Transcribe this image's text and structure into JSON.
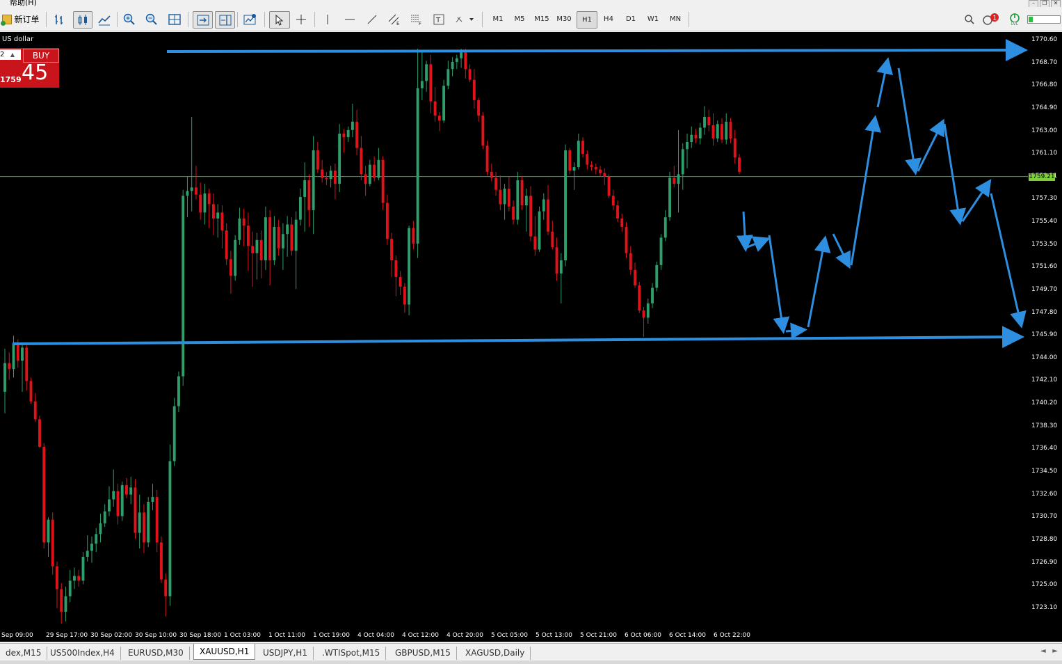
{
  "menu": {
    "help_label": "帮助(H)"
  },
  "toolbar": {
    "new_order_label": "新订单",
    "timeframes": [
      "M1",
      "M5",
      "M15",
      "M30",
      "H1",
      "H4",
      "D1",
      "W1",
      "MN"
    ],
    "active_timeframe": "H1",
    "alert_count": "1",
    "lvl_label": "LVL"
  },
  "chart": {
    "symbol_description": "US dollar",
    "lot_value": "2",
    "buy_label": "BUY",
    "price_small": "1759",
    "price_big": "45",
    "current_price": "1759.21",
    "colors": {
      "background": "#000000",
      "bull": "#2e9e6b",
      "bear": "#e0131b",
      "grid_line": "#22c03a",
      "drawing": "#2e8ee0"
    }
  },
  "price_axis_labels": [
    "1770.60",
    "1768.70",
    "1766.80",
    "1764.90",
    "1763.00",
    "1761.10",
    "1759.21",
    "1757.30",
    "1755.40",
    "1753.50",
    "1751.60",
    "1749.70",
    "1747.80",
    "1745.90",
    "1744.00",
    "1742.10",
    "1740.20",
    "1738.30",
    "1736.40",
    "1734.50",
    "1732.60",
    "1730.70",
    "1728.80",
    "1726.90",
    "1725.00",
    "1723.10"
  ],
  "time_axis_labels": [
    "Sep 09:00",
    "29 Sep 17:00",
    "30 Sep 02:00",
    "30 Sep 10:00",
    "30 Sep 18:00",
    "1 Oct 03:00",
    "1 Oct 11:00",
    "1 Oct 19:00",
    "4 Oct 04:00",
    "4 Oct 12:00",
    "4 Oct 20:00",
    "5 Oct 05:00",
    "5 Oct 13:00",
    "5 Oct 21:00",
    "6 Oct 06:00",
    "6 Oct 14:00",
    "6 Oct 22:00"
  ],
  "tabs": [
    "dex,M15",
    "US500Index,H4",
    "EURUSD,M30",
    "XAUUSD,H1",
    "USDJPY,H1",
    ".WTISpot,M15",
    "GBPUSD,M15",
    "XAGUSD,Daily"
  ],
  "active_tab": "XAUUSD,H1",
  "chart_data": {
    "type": "candlestick",
    "symbol": "XAUUSD",
    "timeframe": "H1",
    "ylim": [
      1721.4,
      1771.3
    ],
    "horizontal_line": 1759.21,
    "candles": [
      [
        1741.2,
        1744.8,
        1739.4,
        1743.6
      ],
      [
        1743.6,
        1744.5,
        1742.2,
        1743.1
      ],
      [
        1743.1,
        1745.9,
        1742.4,
        1745.2
      ],
      [
        1745.2,
        1745.6,
        1743.2,
        1743.8
      ],
      [
        1743.8,
        1745.3,
        1741.2,
        1744.9
      ],
      [
        1744.9,
        1745.1,
        1741.3,
        1742.1
      ],
      [
        1742.1,
        1742.4,
        1740.2,
        1740.4
      ],
      [
        1740.4,
        1741.1,
        1738.7,
        1738.9
      ],
      [
        1738.9,
        1739.2,
        1736.5,
        1736.6
      ],
      [
        1736.6,
        1736.9,
        1728.1,
        1728.6
      ],
      [
        1728.6,
        1730.7,
        1727.4,
        1730.5
      ],
      [
        1730.5,
        1731.1,
        1725.9,
        1726.6
      ],
      [
        1726.6,
        1727.0,
        1723.1,
        1724.7
      ],
      [
        1724.7,
        1725.2,
        1721.8,
        1722.8
      ],
      [
        1722.8,
        1724.9,
        1722.0,
        1724.1
      ],
      [
        1724.1,
        1726.3,
        1723.6,
        1725.4
      ],
      [
        1725.4,
        1726.5,
        1724.7,
        1725.8
      ],
      [
        1725.8,
        1726.3,
        1724.9,
        1725.4
      ],
      [
        1725.4,
        1727.8,
        1725.1,
        1727.4
      ],
      [
        1727.4,
        1729.2,
        1727.0,
        1727.9
      ],
      [
        1727.9,
        1729.1,
        1726.9,
        1728.5
      ],
      [
        1728.5,
        1729.8,
        1727.8,
        1729.3
      ],
      [
        1729.3,
        1731.0,
        1728.6,
        1730.2
      ],
      [
        1730.2,
        1731.8,
        1729.9,
        1731.2
      ],
      [
        1731.2,
        1733.3,
        1730.8,
        1732.2
      ],
      [
        1732.2,
        1734.7,
        1731.6,
        1732.9
      ],
      [
        1732.9,
        1733.5,
        1730.1,
        1730.8
      ],
      [
        1730.8,
        1733.7,
        1730.4,
        1733.4
      ],
      [
        1733.4,
        1734.0,
        1732.3,
        1732.6
      ],
      [
        1732.6,
        1734.1,
        1731.8,
        1733.2
      ],
      [
        1733.2,
        1733.9,
        1728.9,
        1729.4
      ],
      [
        1729.4,
        1732.6,
        1728.1,
        1731.1
      ],
      [
        1731.1,
        1731.8,
        1727.7,
        1728.6
      ],
      [
        1728.6,
        1732.4,
        1728.2,
        1732.0
      ],
      [
        1732.0,
        1733.5,
        1731.3,
        1732.4
      ],
      [
        1732.4,
        1733.0,
        1727.8,
        1728.6
      ],
      [
        1728.6,
        1729.1,
        1725.2,
        1725.5
      ],
      [
        1725.5,
        1726.0,
        1722.4,
        1724.1
      ],
      [
        1724.1,
        1736.8,
        1723.3,
        1735.4
      ],
      [
        1735.4,
        1740.7,
        1735.0,
        1740.0
      ],
      [
        1740.0,
        1742.9,
        1739.5,
        1742.5
      ],
      [
        1742.5,
        1758.1,
        1741.7,
        1757.6
      ],
      [
        1757.6,
        1759.2,
        1755.8,
        1758.0
      ],
      [
        1758.0,
        1764.2,
        1756.3,
        1758.3
      ],
      [
        1758.3,
        1760.1,
        1757.3,
        1757.7
      ],
      [
        1757.7,
        1758.7,
        1755.6,
        1756.2
      ],
      [
        1756.2,
        1758.6,
        1755.2,
        1757.8
      ],
      [
        1757.8,
        1758.2,
        1754.9,
        1756.9
      ],
      [
        1756.9,
        1757.8,
        1754.3,
        1755.7
      ],
      [
        1755.7,
        1756.9,
        1754.1,
        1756.2
      ],
      [
        1756.2,
        1756.8,
        1753.2,
        1754.7
      ],
      [
        1754.7,
        1755.3,
        1751.8,
        1752.3
      ],
      [
        1752.3,
        1753.0,
        1749.4,
        1750.9
      ],
      [
        1750.9,
        1754.3,
        1750.5,
        1753.9
      ],
      [
        1753.9,
        1756.6,
        1753.5,
        1755.7
      ],
      [
        1755.7,
        1756.5,
        1753.4,
        1755.1
      ],
      [
        1755.1,
        1756.2,
        1751.3,
        1753.4
      ],
      [
        1753.4,
        1754.6,
        1750.0,
        1752.8
      ],
      [
        1752.8,
        1754.5,
        1750.6,
        1753.9
      ],
      [
        1753.9,
        1754.7,
        1750.7,
        1752.2
      ],
      [
        1752.2,
        1756.7,
        1751.4,
        1755.8
      ],
      [
        1755.8,
        1756.4,
        1750.1,
        1752.2
      ],
      [
        1752.2,
        1755.9,
        1751.8,
        1755.0
      ],
      [
        1755.0,
        1755.6,
        1752.6,
        1753.2
      ],
      [
        1753.2,
        1755.3,
        1751.4,
        1754.4
      ],
      [
        1754.4,
        1755.9,
        1752.5,
        1755.2
      ],
      [
        1755.2,
        1755.8,
        1752.6,
        1753.0
      ],
      [
        1753.0,
        1756.3,
        1749.8,
        1755.6
      ],
      [
        1755.6,
        1758.2,
        1755.1,
        1757.5
      ],
      [
        1757.5,
        1760.4,
        1754.6,
        1758.9
      ],
      [
        1758.9,
        1759.4,
        1755.0,
        1756.4
      ],
      [
        1756.4,
        1762.6,
        1754.4,
        1761.4
      ],
      [
        1761.4,
        1762.1,
        1759.5,
        1759.8
      ],
      [
        1759.8,
        1760.6,
        1758.7,
        1759.1
      ],
      [
        1759.1,
        1759.6,
        1758.5,
        1759.0
      ],
      [
        1759.0,
        1760.1,
        1758.3,
        1759.7
      ],
      [
        1759.7,
        1760.3,
        1757.3,
        1758.6
      ],
      [
        1758.6,
        1763.6,
        1757.9,
        1762.8
      ],
      [
        1762.8,
        1763.2,
        1761.2,
        1762.5
      ],
      [
        1762.5,
        1763.4,
        1762.1,
        1763.1
      ],
      [
        1763.1,
        1765.3,
        1762.5,
        1763.8
      ],
      [
        1763.8,
        1764.8,
        1761.0,
        1761.6
      ],
      [
        1761.6,
        1762.6,
        1758.9,
        1759.4
      ],
      [
        1759.4,
        1760.1,
        1757.6,
        1758.6
      ],
      [
        1758.6,
        1760.6,
        1758.4,
        1760.2
      ],
      [
        1760.2,
        1760.9,
        1758.8,
        1759.1
      ],
      [
        1759.1,
        1761.6,
        1758.9,
        1760.6
      ],
      [
        1760.6,
        1760.9,
        1756.4,
        1757.0
      ],
      [
        1757.0,
        1757.7,
        1753.5,
        1754.0
      ],
      [
        1754.0,
        1754.5,
        1750.8,
        1752.2
      ],
      [
        1752.2,
        1752.6,
        1749.2,
        1750.8
      ],
      [
        1750.8,
        1751.3,
        1749.3,
        1750.0
      ],
      [
        1750.0,
        1750.3,
        1747.8,
        1748.5
      ],
      [
        1748.5,
        1755.1,
        1747.6,
        1754.9
      ],
      [
        1754.9,
        1755.5,
        1753.1,
        1753.6
      ],
      [
        1753.6,
        1769.9,
        1752.4,
        1766.6
      ],
      [
        1766.6,
        1769.7,
        1765.6,
        1767.2
      ],
      [
        1767.2,
        1768.9,
        1766.3,
        1768.6
      ],
      [
        1768.6,
        1769.4,
        1764.5,
        1765.5
      ],
      [
        1765.5,
        1766.7,
        1763.8,
        1764.3
      ],
      [
        1764.3,
        1764.6,
        1763.0,
        1763.9
      ],
      [
        1763.9,
        1767.3,
        1763.7,
        1766.8
      ],
      [
        1766.8,
        1768.9,
        1766.5,
        1768.2
      ],
      [
        1768.2,
        1769.2,
        1767.6,
        1768.8
      ],
      [
        1768.8,
        1769.4,
        1768.2,
        1769.1
      ],
      [
        1769.1,
        1769.9,
        1768.3,
        1769.6
      ],
      [
        1769.6,
        1769.9,
        1767.4,
        1768.2
      ],
      [
        1768.2,
        1768.6,
        1767.1,
        1767.3
      ],
      [
        1767.3,
        1768.2,
        1764.9,
        1765.6
      ],
      [
        1765.6,
        1765.8,
        1763.8,
        1764.3
      ],
      [
        1764.3,
        1764.6,
        1761.5,
        1761.8
      ],
      [
        1761.8,
        1762.2,
        1759.3,
        1759.6
      ],
      [
        1759.6,
        1760.3,
        1758.8,
        1759.1
      ],
      [
        1759.1,
        1759.6,
        1757.6,
        1758.1
      ],
      [
        1758.1,
        1759.3,
        1756.4,
        1756.9
      ],
      [
        1756.9,
        1758.6,
        1755.6,
        1758.2
      ],
      [
        1758.2,
        1759.2,
        1756.3,
        1756.7
      ],
      [
        1756.7,
        1757.2,
        1755.2,
        1755.6
      ],
      [
        1755.6,
        1759.6,
        1755.2,
        1758.9
      ],
      [
        1758.9,
        1759.2,
        1756.4,
        1756.8
      ],
      [
        1756.8,
        1758.2,
        1754.6,
        1757.6
      ],
      [
        1757.6,
        1758.4,
        1753.8,
        1754.2
      ],
      [
        1754.2,
        1755.9,
        1752.6,
        1753.1
      ],
      [
        1753.1,
        1756.7,
        1752.9,
        1756.3
      ],
      [
        1756.3,
        1757.8,
        1755.6,
        1757.3
      ],
      [
        1757.3,
        1758.5,
        1754.3,
        1754.6
      ],
      [
        1754.6,
        1755.5,
        1753.1,
        1753.3
      ],
      [
        1753.3,
        1754.1,
        1750.5,
        1751.1
      ],
      [
        1751.1,
        1752.8,
        1748.6,
        1752.2
      ],
      [
        1752.2,
        1761.9,
        1751.7,
        1761.4
      ],
      [
        1761.4,
        1761.6,
        1759.4,
        1759.7
      ],
      [
        1759.7,
        1760.4,
        1758.1,
        1760.0
      ],
      [
        1760.0,
        1762.8,
        1759.8,
        1762.2
      ],
      [
        1762.2,
        1762.5,
        1760.8,
        1761.1
      ],
      [
        1761.1,
        1761.4,
        1759.8,
        1760.2
      ],
      [
        1760.2,
        1760.5,
        1759.7,
        1760.0
      ],
      [
        1760.0,
        1760.3,
        1759.4,
        1759.8
      ],
      [
        1759.8,
        1760.1,
        1759.2,
        1759.5
      ],
      [
        1759.5,
        1759.9,
        1758.5,
        1759.2
      ],
      [
        1759.2,
        1759.4,
        1757.4,
        1757.6
      ],
      [
        1757.6,
        1758.1,
        1756.4,
        1756.8
      ],
      [
        1756.8,
        1757.2,
        1755.4,
        1755.7
      ],
      [
        1755.7,
        1756.1,
        1754.6,
        1755.0
      ],
      [
        1755.0,
        1755.4,
        1752.4,
        1752.8
      ],
      [
        1752.8,
        1753.4,
        1751.0,
        1751.4
      ],
      [
        1751.4,
        1752.0,
        1749.9,
        1750.1
      ],
      [
        1750.1,
        1750.4,
        1747.8,
        1748.0
      ],
      [
        1748.0,
        1748.3,
        1745.8,
        1747.4
      ],
      [
        1747.4,
        1749.0,
        1746.9,
        1748.6
      ],
      [
        1748.6,
        1750.3,
        1748.2,
        1749.9
      ],
      [
        1749.9,
        1752.1,
        1749.6,
        1751.8
      ],
      [
        1751.8,
        1754.4,
        1751.4,
        1754.1
      ],
      [
        1754.1,
        1756.4,
        1753.8,
        1755.8
      ],
      [
        1755.8,
        1759.6,
        1755.5,
        1759.1
      ],
      [
        1759.1,
        1760.1,
        1758.3,
        1758.6
      ],
      [
        1758.6,
        1763.1,
        1756.2,
        1759.4
      ],
      [
        1759.4,
        1762.0,
        1758.1,
        1761.5
      ],
      [
        1761.5,
        1762.8,
        1759.9,
        1762.1
      ],
      [
        1762.1,
        1763.4,
        1761.6,
        1762.7
      ],
      [
        1762.7,
        1763.2,
        1762.0,
        1762.4
      ],
      [
        1762.4,
        1763.7,
        1761.9,
        1763.3
      ],
      [
        1763.3,
        1765.1,
        1762.7,
        1764.2
      ],
      [
        1764.2,
        1764.8,
        1763.0,
        1763.5
      ],
      [
        1763.5,
        1764.5,
        1761.8,
        1762.4
      ],
      [
        1762.4,
        1763.9,
        1762.1,
        1763.6
      ],
      [
        1763.6,
        1764.1,
        1762.0,
        1762.3
      ],
      [
        1762.3,
        1764.5,
        1761.9,
        1763.8
      ],
      [
        1763.8,
        1764.1,
        1762.0,
        1762.4
      ],
      [
        1762.4,
        1763.1,
        1760.3,
        1760.8
      ],
      [
        1760.8,
        1761.1,
        1759.4,
        1759.6
      ]
    ]
  }
}
